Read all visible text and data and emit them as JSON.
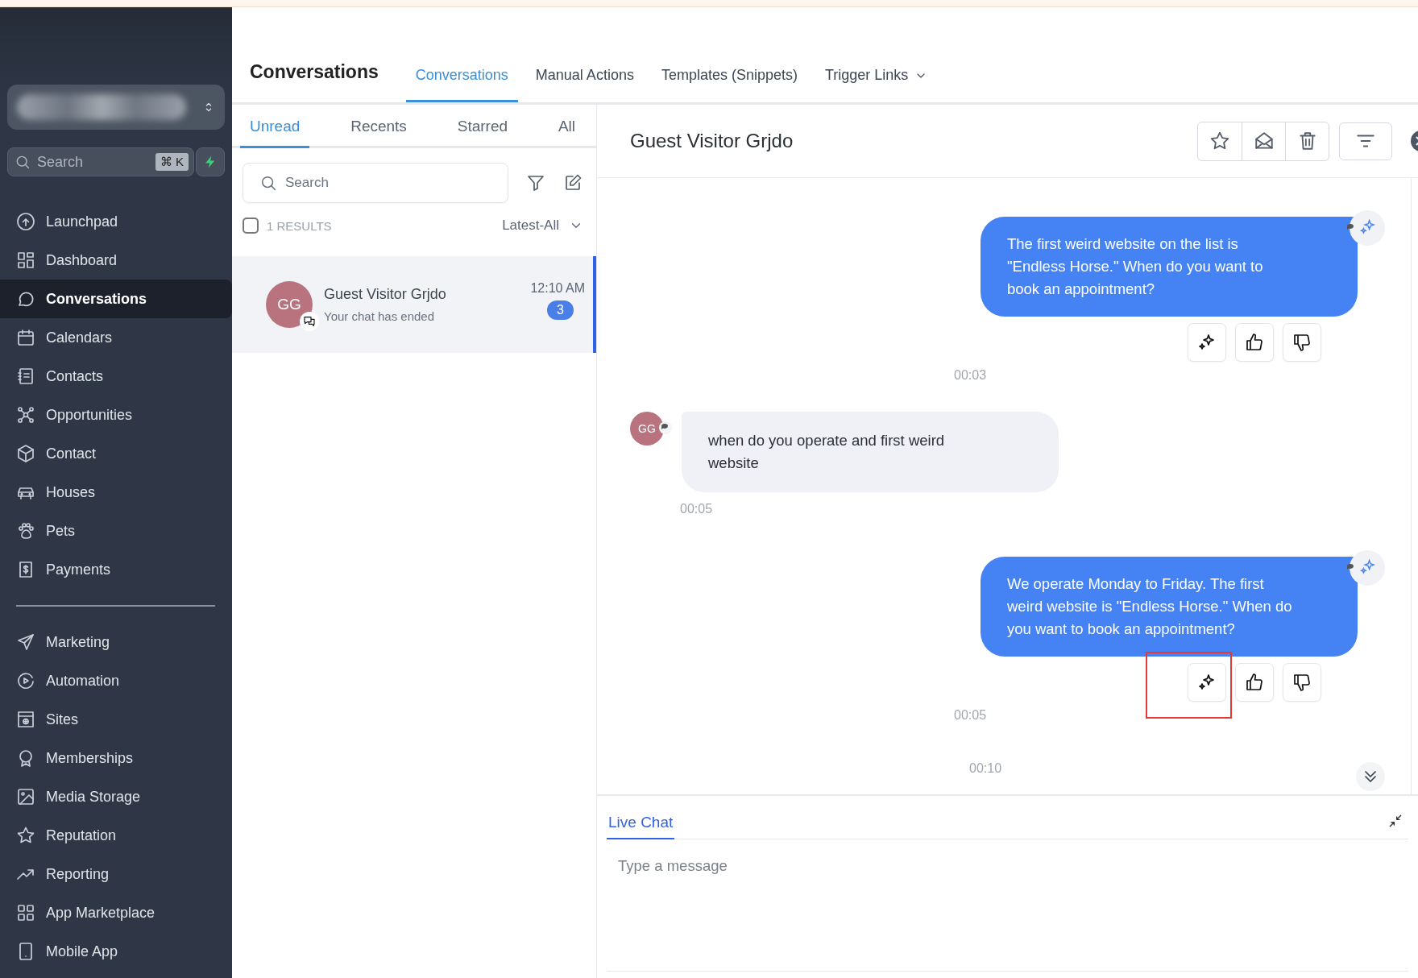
{
  "sidebar": {
    "search": {
      "placeholder": "Search",
      "shortcut": "⌘ K"
    },
    "nav_items": [
      {
        "label": "Launchpad",
        "selected": false
      },
      {
        "label": "Dashboard",
        "selected": false
      },
      {
        "label": "Conversations",
        "selected": true
      },
      {
        "label": "Calendars",
        "selected": false
      },
      {
        "label": "Contacts",
        "selected": false
      },
      {
        "label": "Opportunities",
        "selected": false
      },
      {
        "label": "Contact",
        "selected": false
      },
      {
        "label": "Houses",
        "selected": false
      },
      {
        "label": "Pets",
        "selected": false
      },
      {
        "label": "Payments",
        "selected": false
      }
    ],
    "nav_items_2": [
      {
        "label": "Marketing",
        "selected": false
      },
      {
        "label": "Automation",
        "selected": false
      },
      {
        "label": "Sites",
        "selected": false
      },
      {
        "label": "Memberships",
        "selected": false
      },
      {
        "label": "Media Storage",
        "selected": false
      },
      {
        "label": "Reputation",
        "selected": false
      },
      {
        "label": "Reporting",
        "selected": false
      },
      {
        "label": "App Marketplace",
        "selected": false
      },
      {
        "label": "Mobile App",
        "selected": false
      }
    ]
  },
  "header": {
    "title": "Conversations",
    "tabs": [
      {
        "label": "Conversations",
        "selected": true,
        "kind": "link"
      },
      {
        "label": "Manual Actions",
        "selected": false,
        "kind": "link"
      },
      {
        "label": "Templates (Snippets)",
        "selected": false,
        "kind": "link"
      },
      {
        "label": "Trigger Links",
        "selected": false,
        "kind": "dropdown"
      }
    ]
  },
  "list": {
    "tabs": [
      {
        "label": "Unread",
        "selected": true
      },
      {
        "label": "Recents",
        "selected": false
      },
      {
        "label": "Starred",
        "selected": false
      },
      {
        "label": "All",
        "selected": false
      }
    ],
    "search": {
      "placeholder": "Search"
    },
    "select_all": {
      "checked": false
    },
    "results": "1 RESULTS",
    "sort": "Latest-All",
    "conversations": [
      {
        "initials": "GG",
        "name": "Guest Visitor Grjdo",
        "preview": "Your chat has ended",
        "time": "12:10 AM",
        "unread": "3",
        "selected": true
      }
    ]
  },
  "chat": {
    "title": "Guest Visitor Grjdo",
    "messages": [
      {
        "kind": "outgoing",
        "text": "The first weird website on the list is \"Endless Horse.\" When do you want to book an appointment?",
        "time": "00:03",
        "highlighted": false
      },
      {
        "kind": "incoming",
        "initials": "GG",
        "text": "when do you operate and first weird website",
        "time": "00:05"
      },
      {
        "kind": "outgoing",
        "text": "We operate Monday to Friday. The first weird website is \"Endless Horse.\" When do you want to book an appointment?",
        "time": "00:05",
        "highlighted": true
      }
    ],
    "last_time": "00:10",
    "composer": {
      "tabs": [
        {
          "label": "Live Chat",
          "selected": true
        }
      ],
      "placeholder": "Type a message"
    }
  }
}
